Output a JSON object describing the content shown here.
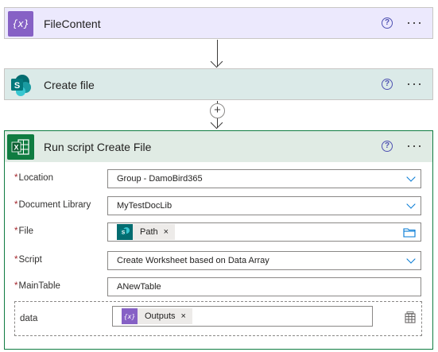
{
  "steps": {
    "file_content": {
      "title": "FileContent",
      "icon": "variable-braces-icon",
      "color": "#ece9fd",
      "icon_bg": "#8661c5"
    },
    "create_file": {
      "title": "Create file",
      "icon": "sharepoint-icon",
      "color": "#dbeae8",
      "icon_bg": "#036c70"
    },
    "run_script": {
      "title": "Run script Create File",
      "icon": "excel-icon",
      "color": "#e0ebe4",
      "icon_bg": "#107c41"
    }
  },
  "help_glyph": "?",
  "more_glyph": "···",
  "add_glyph": "+",
  "required_marker": "*",
  "form": {
    "location": {
      "label": "Location",
      "value": "Group - DamoBird365"
    },
    "document_library": {
      "label": "Document Library",
      "value": "MyTestDocLib"
    },
    "file": {
      "label": "File",
      "token": "Path",
      "token_icon": "sharepoint-icon"
    },
    "script": {
      "label": "Script",
      "value": "Create Worksheet based on Data Array"
    },
    "main_table": {
      "label": "MainTable",
      "value": "ANewTable"
    },
    "data": {
      "label": "data",
      "token": "Outputs",
      "token_icon": "variable-braces-icon"
    }
  },
  "token_remove": "×"
}
